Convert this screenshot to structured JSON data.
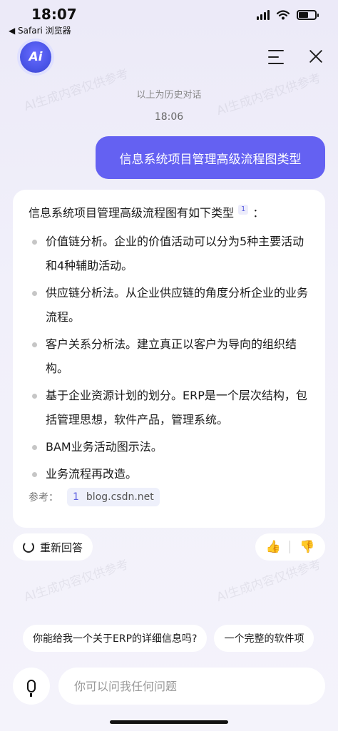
{
  "status": {
    "time": "18:07",
    "back_app": "◀ Safari 浏览器"
  },
  "header": {
    "logo": "Ai"
  },
  "history": {
    "divider": "以上为历史对话",
    "time": "18:06"
  },
  "user_message": "信息系统项目管理高级流程图类型",
  "answer": {
    "intro": "信息系统项目管理高级流程图有如下类型",
    "cite": "1",
    "colon": "：",
    "items": [
      "价值链分析。企业的价值活动可以分为5种主要活动和4种辅助活动。",
      "供应链分析法。从企业供应链的角度分析企业的业务流程。",
      "客户关系分析法。建立真正以客户为导向的组织结构。",
      "基于企业资源计划的划分。ERP是一个层次结构，包括管理思想，软件产品，管理系统。",
      "BAM业务活动图示法。",
      "业务流程再改造。"
    ],
    "ref_label": "参考：",
    "ref_num": "1",
    "ref_site": "blog.csdn.net"
  },
  "actions": {
    "regenerate": "重新回答",
    "like": "👍",
    "dislike": "👎"
  },
  "suggestions": [
    "你能给我一个关于ERP的详细信息吗?",
    "一个完整的软件项"
  ],
  "input": {
    "placeholder": "你可以问我任何问题"
  },
  "watermark": "AI生成内容仅供参考",
  "colors": {
    "accent": "#6461f2",
    "logo": "#4a55e8"
  }
}
